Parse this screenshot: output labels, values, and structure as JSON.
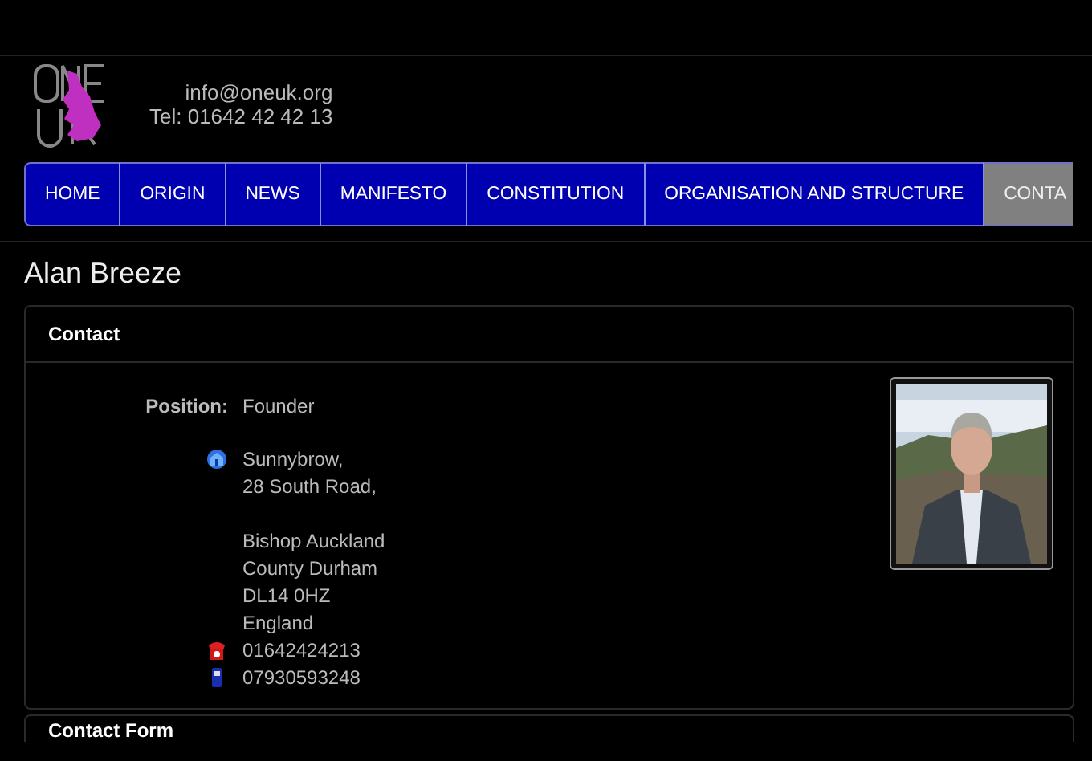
{
  "header": {
    "logo": {
      "kind": "logo"
    },
    "email": "info@oneuk.org",
    "phone": "Tel: 01642 42 42 13"
  },
  "nav": [
    {
      "label": "HOME",
      "selected": false
    },
    {
      "label": "ORIGIN",
      "selected": false
    },
    {
      "label": "NEWS",
      "selected": false
    },
    {
      "label": "MANIFESTO",
      "selected": false
    },
    {
      "label": "CONSTITUTION",
      "selected": false
    },
    {
      "label": "ORGANISATION AND STRUCTURE",
      "selected": false
    },
    {
      "label": "CONTA",
      "selected": true
    }
  ],
  "page_title": "Alan Breeze",
  "contact_card": {
    "title": "Contact",
    "position_label": "Position:",
    "position": "Founder",
    "address": {
      "lines_1": [
        "Sunnybrow,",
        "28 South Road,"
      ],
      "lines_2": [
        "Bishop Auckland",
        "County Durham",
        "DL14 0HZ",
        "England"
      ]
    },
    "phones": [
      {
        "kind": "landline",
        "number": "01642424213"
      },
      {
        "kind": "mobile",
        "number": "07930593248"
      }
    ]
  },
  "form_card": {
    "title": "Contact Form"
  }
}
